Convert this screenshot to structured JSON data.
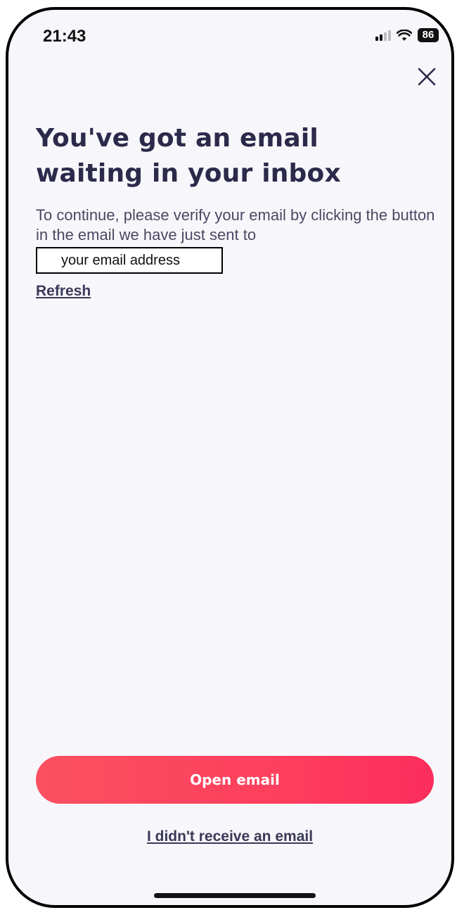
{
  "status_bar": {
    "time": "21:43",
    "battery": "86",
    "signal_icon": "cellular-signal-icon",
    "wifi_icon": "wifi-icon"
  },
  "header": {
    "close_icon": "close-icon"
  },
  "main": {
    "headline": "You've got an email waiting in your inbox",
    "instructions": "To continue, please verify your email by clicking the button in the email we have just sent to",
    "email_placeholder": "your email address",
    "refresh_label": "Refresh"
  },
  "actions": {
    "open_email_label": "Open email",
    "no_email_label": "I didn't receive an email"
  },
  "colors": {
    "accent": "#fd3f5e",
    "headline": "#2c2a4a",
    "body_text": "#4a4862",
    "background": "#f7f7fb"
  }
}
